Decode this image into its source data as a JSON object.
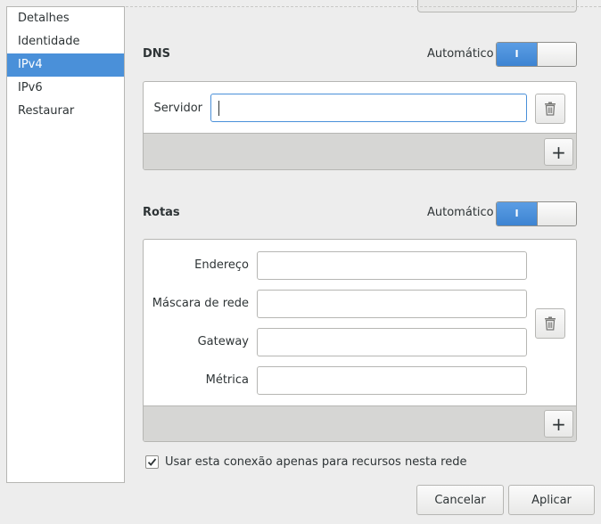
{
  "sidebar": {
    "items": [
      {
        "label": "Detalhes"
      },
      {
        "label": "Identidade"
      },
      {
        "label": "IPv4"
      },
      {
        "label": "IPv6"
      },
      {
        "label": "Restaurar"
      }
    ],
    "selected": "IPv4"
  },
  "dns": {
    "title": "DNS",
    "auto_label": "Automático",
    "auto_on": true,
    "switch_on_text": "I",
    "server_label": "Servidor",
    "server_value": ""
  },
  "routes": {
    "title": "Rotas",
    "auto_label": "Automático",
    "auto_on": true,
    "switch_on_text": "I",
    "address_label": "Endereço",
    "netmask_label": "Máscara de rede",
    "gateway_label": "Gateway",
    "metric_label": "Métrica",
    "address_value": "",
    "netmask_value": "",
    "gateway_value": "",
    "metric_value": ""
  },
  "restrict": {
    "label": "Usar esta conexão apenas para recursos nesta rede",
    "checked": true
  },
  "buttons": {
    "cancel": "Cancelar",
    "apply": "Aplicar"
  },
  "icons": {
    "delete": "trash-icon",
    "add": "plus-icon",
    "check": "checkmark-icon"
  },
  "colors": {
    "accent": "#4a90d9"
  }
}
